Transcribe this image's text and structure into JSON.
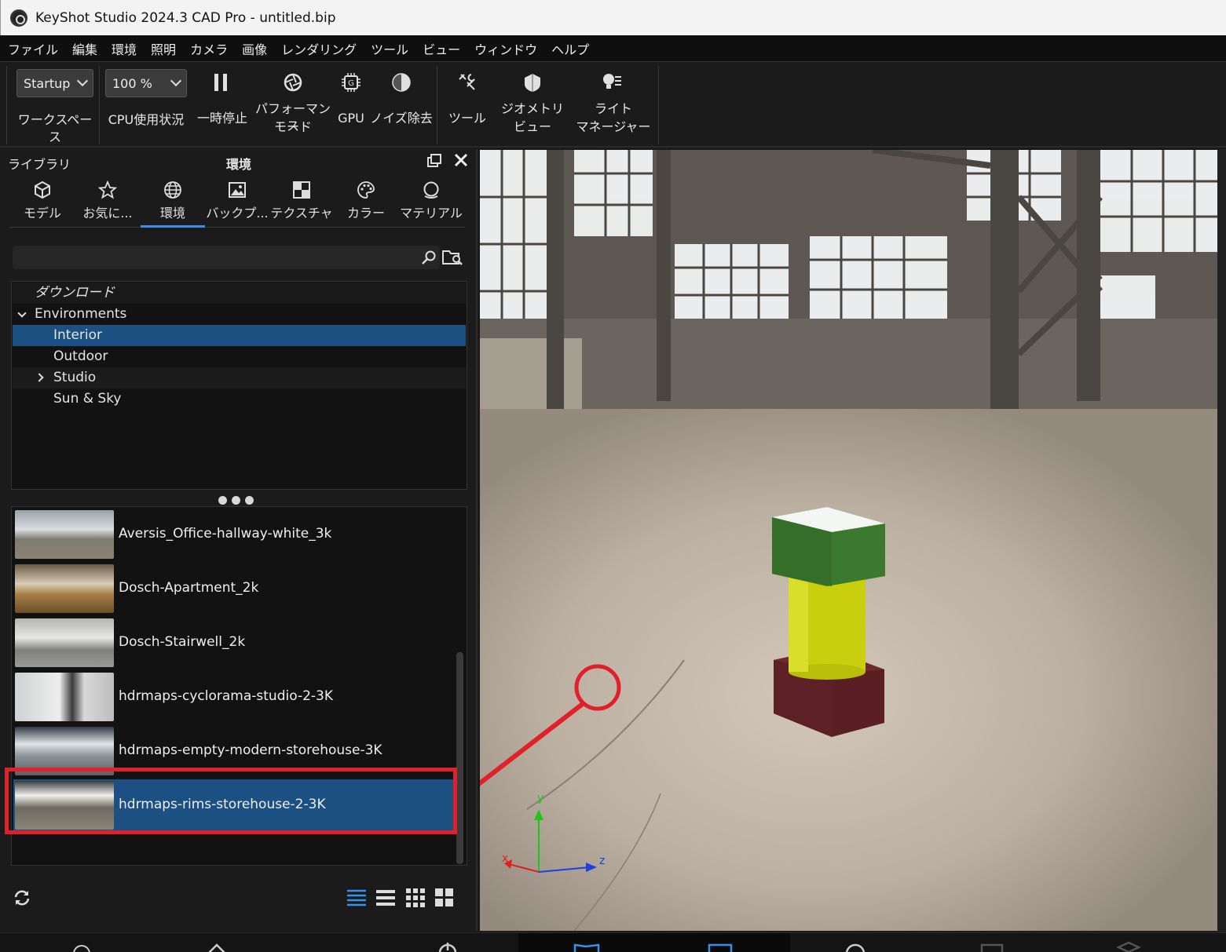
{
  "window": {
    "title": "KeyShot Studio 2024.3 CAD Pro - untitled.bip"
  },
  "menu": [
    "ファイル",
    "編集",
    "環境",
    "照明",
    "カメラ",
    "画像",
    "レンダリング",
    "ツール",
    "ビュー",
    "ウィンドウ",
    "ヘルプ"
  ],
  "toolbar": {
    "workspace_value": "Startup",
    "workspace_label": "ワークスペース",
    "cpu_value": "100 %",
    "cpu_label": "CPU使用状況",
    "pause_label": "一時停止",
    "performance_label_1": "パフォーマンス",
    "performance_label_2": "モード",
    "gpu_label": "GPU",
    "denoise_label": "ノイズ除去",
    "tools_label": "ツール",
    "geometry_label_1": "ジオメトリ",
    "geometry_label_2": "ビュー",
    "light_label_1": "ライト",
    "light_label_2": "マネージャー"
  },
  "panel": {
    "library_label": "ライブラリ",
    "title": "環境",
    "tabs": [
      {
        "label": "モデル",
        "icon": "model-icon"
      },
      {
        "label": "お気に...",
        "icon": "star-icon"
      },
      {
        "label": "環境",
        "icon": "globe-icon"
      },
      {
        "label": "バックプ...",
        "icon": "image-icon"
      },
      {
        "label": "テクスチャ",
        "icon": "checker-icon"
      },
      {
        "label": "カラー",
        "icon": "palette-icon"
      },
      {
        "label": "マテリアル",
        "icon": "sphere-icon"
      }
    ],
    "search_placeholder": "",
    "tree": {
      "download": "ダウンロード",
      "environments": "Environments",
      "interior": "Interior",
      "outdoor": "Outdoor",
      "studio": "Studio",
      "sun_sky": "Sun & Sky"
    },
    "items": [
      "Aversis_Office-hallway-white_3k",
      "Dosch-Apartment_2k",
      "Dosch-Stairwell_2k",
      "hdrmaps-cyclorama-studio-2-3K",
      "hdrmaps-empty-modern-storehouse-3K",
      "hdrmaps-rims-storehouse-2-3K"
    ]
  },
  "axes": {
    "x": "x",
    "y": "y",
    "z": "z"
  },
  "colors": {
    "accent": "#3a8fe8",
    "selection": "#1c4f82",
    "annotation": "#e0202a"
  }
}
